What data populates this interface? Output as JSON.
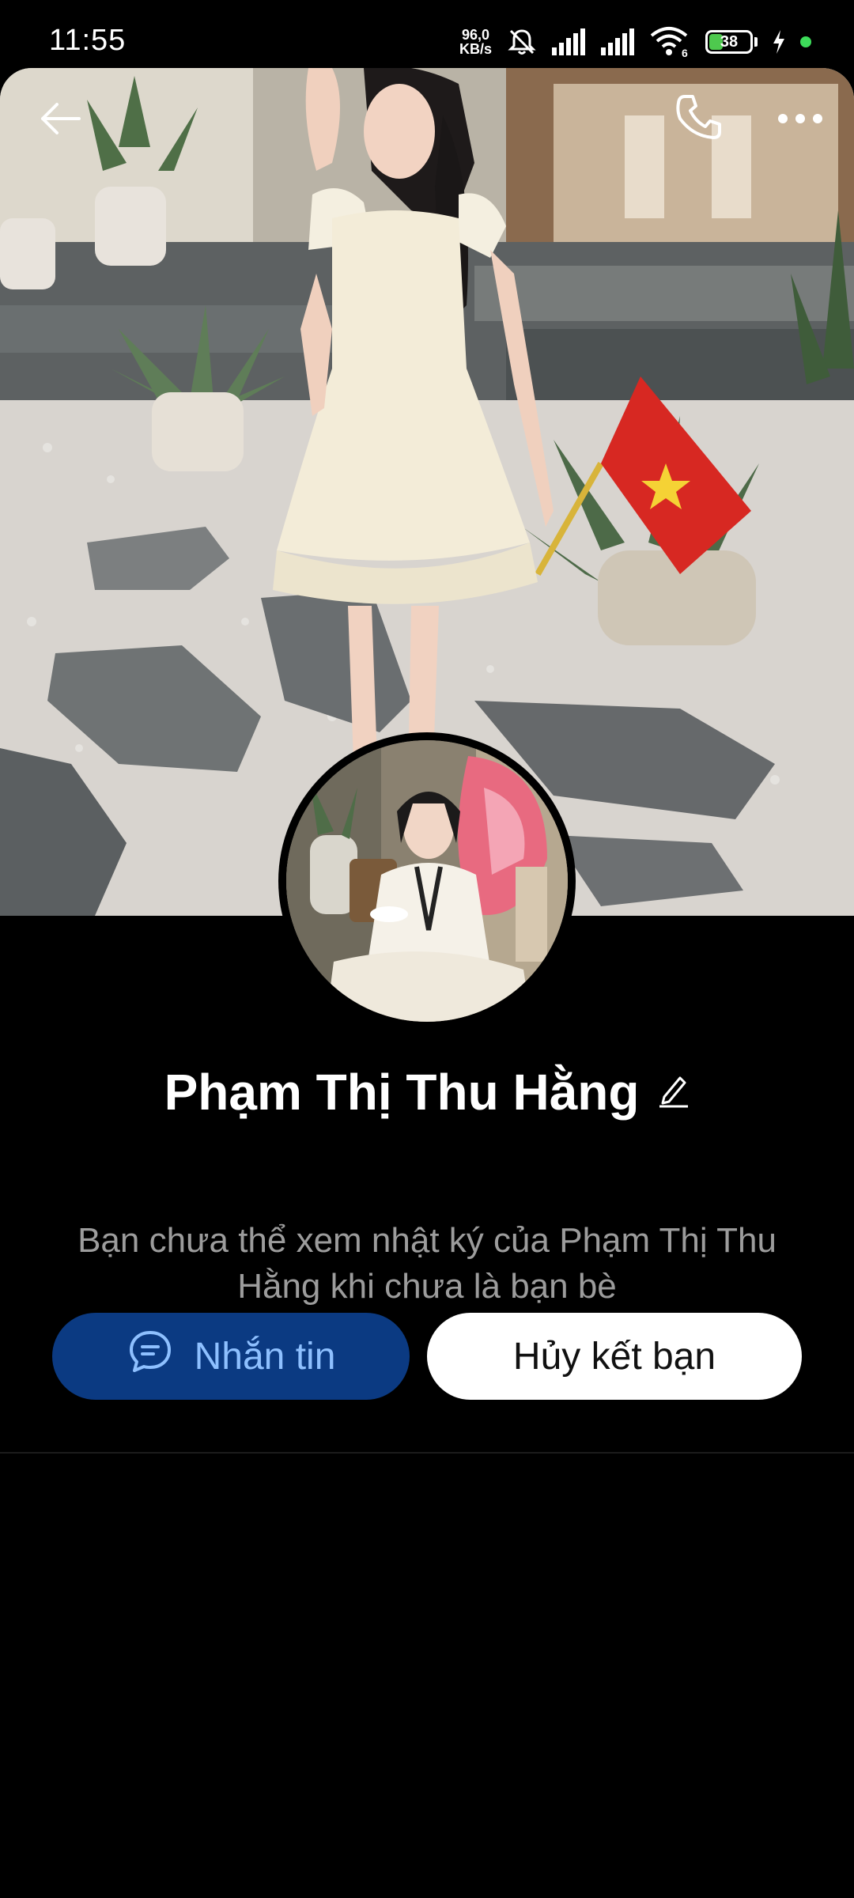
{
  "status_bar": {
    "time": "11:55",
    "net_speed_value": "96,0",
    "net_speed_unit": "KB/s",
    "battery_level": "38",
    "battery_fill_pct": 38,
    "wifi_label": "6",
    "icons": [
      "mute-bell-icon",
      "signal-icon",
      "signal-icon",
      "wifi-icon",
      "battery-icon",
      "charging-bolt-icon",
      "notification-dot-icon"
    ]
  },
  "header": {
    "back_icon": "arrow-left-icon",
    "call_icon": "phone-icon",
    "more_icon": "more-dots-icon"
  },
  "profile": {
    "name": "Phạm Thị Thu Hằng",
    "edit_icon": "pencil-icon",
    "privacy_note": "Bạn chưa thể xem nhật ký của Phạm Thị Thu Hằng khi chưa là bạn bè"
  },
  "actions": {
    "message_label": "Nhắn tin",
    "message_icon": "chat-bubble-icon",
    "unfriend_label": "Hủy kết bạn"
  },
  "colors": {
    "background": "#000000",
    "message_button_bg": "#0b3a82",
    "message_button_text": "#8ec0ff",
    "unfriend_button_bg": "#ffffff",
    "secondary_text": "#9c9c9c"
  }
}
